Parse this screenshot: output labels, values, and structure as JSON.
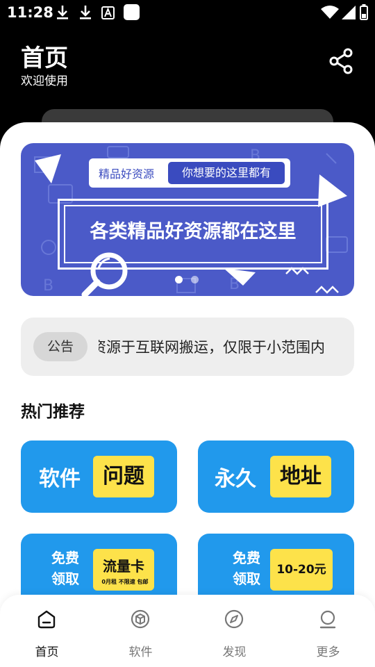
{
  "status_bar": {
    "time": "11:28"
  },
  "header": {
    "title": "首页",
    "subtitle": "欢迎使用",
    "share_icon": "share-icon"
  },
  "banner": {
    "tag_left": "精品好资源",
    "tag_right": "你想要的这里都有",
    "headline": "各类精品好资源都在这里",
    "slide_count": 2,
    "active_slide": 1
  },
  "notice": {
    "badge": "公告",
    "text": "资源于互联网搬运，仅限于小范围内"
  },
  "section": {
    "title": "热门推荐"
  },
  "cards": [
    {
      "left": "软件",
      "right": "问题"
    },
    {
      "left": "永久",
      "right": "地址"
    },
    {
      "left_line1": "免费",
      "left_line2": "领取",
      "right": "流量卡",
      "right_small": "0月租  不限速  包邮"
    },
    {
      "left_line1": "免费",
      "left_line2": "领取",
      "right": "10-20元"
    }
  ],
  "nav": [
    {
      "label": "首页",
      "icon": "home-icon",
      "active": true
    },
    {
      "label": "软件",
      "icon": "cube-icon",
      "active": false
    },
    {
      "label": "发现",
      "icon": "compass-icon",
      "active": false
    },
    {
      "label": "更多",
      "icon": "person-icon",
      "active": false
    }
  ],
  "colors": {
    "banner_bg": "#4b5ac8",
    "card_bg": "#2199ec",
    "card_accent": "#fde24a",
    "notice_bg": "#eeeeee"
  }
}
